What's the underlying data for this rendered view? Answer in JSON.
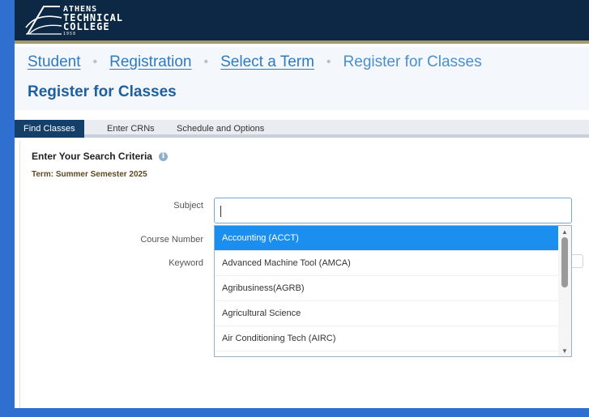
{
  "colors": {
    "header_bg": "#0d2844",
    "accent_gold": "#a59a6d",
    "link": "#2d7bc4",
    "title": "#1e5f9e",
    "active_tab": "#133f68",
    "selected_option": "#1a8ff0",
    "outer_border": "#2f6fd0"
  },
  "logo": {
    "lines": [
      "ATHENS",
      "TECHNICAL",
      "COLLEGE",
      "1958"
    ]
  },
  "breadcrumb": {
    "items": [
      {
        "label": "Student",
        "link": true
      },
      {
        "label": "Registration",
        "link": true
      },
      {
        "label": "Select a Term",
        "link": true
      },
      {
        "label": "Register for Classes",
        "link": false
      }
    ],
    "separator": "•"
  },
  "page_title": "Register for Classes",
  "tabs": [
    {
      "label": "Find Classes",
      "active": true
    },
    {
      "label": "Enter CRNs",
      "active": false
    },
    {
      "label": "Schedule and Options",
      "active": false
    }
  ],
  "search": {
    "heading": "Enter Your Search Criteria",
    "info_icon": "info-icon",
    "term": "Term: Summer Semester 2025",
    "fields": {
      "subject_label": "Subject",
      "subject_value": "",
      "course_number_label": "Course Number",
      "keyword_label": "Keyword"
    }
  },
  "subject_dropdown": {
    "options": [
      {
        "label": "Accounting (ACCT)",
        "selected": true
      },
      {
        "label": "Advanced Machine Tool (AMCA)",
        "selected": false
      },
      {
        "label": "Agribusiness(AGRB)",
        "selected": false
      },
      {
        "label": "Agricultural Science",
        "selected": false
      },
      {
        "label": "Air Conditioning Tech (AIRC)",
        "selected": false
      }
    ],
    "scroll_up_icon": "▲",
    "scroll_down_icon": "▼"
  }
}
